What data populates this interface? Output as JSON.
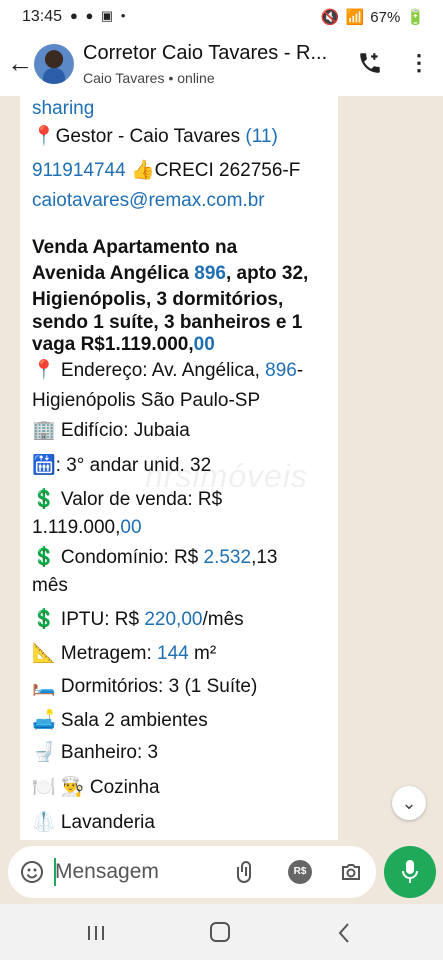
{
  "status": {
    "time": "13:45",
    "battery": "67%"
  },
  "header": {
    "back_icon": "arrow-left-icon",
    "title": "Corretor Caio Tavares - R...",
    "subtitle_name": "Caio Tavares",
    "subtitle_status": "online"
  },
  "message": {
    "lines": [
      {
        "text": "sharing",
        "style": "link"
      },
      {
        "parts": [
          {
            "t": "📍Gestor  - Caio Tavares "
          },
          {
            "t": "(11)",
            "link": true
          }
        ]
      },
      {
        "parts": [
          {
            "t": "911914744",
            "link": true
          },
          {
            "t": " 👍CRECI 262756-F"
          }
        ]
      },
      {
        "text": "caiotavares@remax.com.br",
        "style": "link"
      },
      {
        "parts": [
          {
            "t": "Venda Apartamento na"
          }
        ],
        "bold": true
      },
      {
        "parts": [
          {
            "t": "Avenida Angélica "
          },
          {
            "t": "896",
            "link": true
          },
          {
            "t": ", apto 32,"
          }
        ],
        "bold": true
      },
      {
        "parts": [
          {
            "t": "Higienópolis, 3 dormitórios,"
          }
        ],
        "bold": true
      },
      {
        "parts": [
          {
            "t": "sendo 1 suíte, 3 banheiros e 1"
          }
        ],
        "bold": true
      },
      {
        "parts": [
          {
            "t": "vaga R$1.119.000,"
          },
          {
            "t": "00",
            "link": true
          }
        ],
        "bold": true
      },
      {
        "parts": [
          {
            "t": "📍 Endereço: Av. Angélica, "
          },
          {
            "t": "896",
            "link": true
          },
          {
            "t": "-"
          }
        ]
      },
      {
        "parts": [
          {
            "t": "Higienópolis São Paulo-SP"
          }
        ]
      },
      {
        "parts": [
          {
            "t": "🏢 Edifício: Jubaia"
          }
        ]
      },
      {
        "parts": [
          {
            "t": "🛗: 3° andar unid. 32"
          }
        ]
      },
      {
        "parts": [
          {
            "t": "💲 Valor de venda: R$"
          }
        ]
      },
      {
        "parts": [
          {
            "t": "1.119.000,"
          },
          {
            "t": "00",
            "link": true
          }
        ]
      },
      {
        "parts": [
          {
            "t": "💲 Condomínio: R$ "
          },
          {
            "t": "2.532",
            "link": true
          },
          {
            "t": ",13"
          }
        ]
      },
      {
        "parts": [
          {
            "t": "mês"
          }
        ]
      },
      {
        "parts": [
          {
            "t": "💲 IPTU: R$ "
          },
          {
            "t": "220,00",
            "link": true
          },
          {
            "t": "/mês"
          }
        ]
      },
      {
        "parts": [
          {
            "t": "📐 Metragem: "
          },
          {
            "t": "144",
            "link": true
          },
          {
            "t": " m²"
          }
        ]
      },
      {
        "parts": [
          {
            "t": "🛏️ Dormitórios: 3 (1 Suíte)"
          }
        ]
      },
      {
        "parts": [
          {
            "t": "🛋️ Sala 2 ambientes"
          }
        ]
      },
      {
        "parts": [
          {
            "t": "🚽 Banheiro: 3"
          }
        ]
      },
      {
        "parts": [
          {
            "t": "🍽️ 👨‍🍳 Cozinha"
          }
        ]
      },
      {
        "parts": [
          {
            "t": "🥼 Lavanderia"
          }
        ]
      }
    ],
    "watermark": "hrsimóveis"
  },
  "composer": {
    "placeholder": "Mensagem",
    "pay_label": "R$"
  },
  "colors": {
    "link": "#1f6fb5",
    "accent": "#1faa59"
  }
}
